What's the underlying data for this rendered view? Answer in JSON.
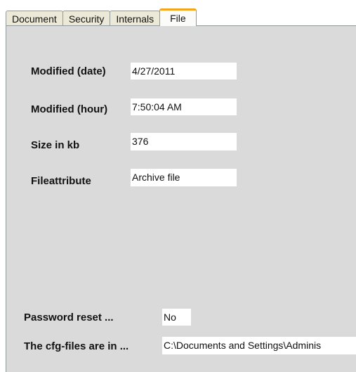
{
  "tabs": [
    {
      "label": "Document"
    },
    {
      "label": "Security"
    },
    {
      "label": "Internals"
    },
    {
      "label": "File",
      "active": true
    }
  ],
  "fields": {
    "modified_date": {
      "label": "Modified (date)",
      "value": "4/27/2011"
    },
    "modified_hour": {
      "label": "Modified (hour)",
      "value": "7:50:04 AM"
    },
    "size_kb": {
      "label": "Size in kb",
      "value": "376"
    },
    "file_attribute": {
      "label": "Fileattribute",
      "value": "Archive file"
    },
    "password_reset": {
      "label": "Password reset ...",
      "value": "No"
    },
    "cfg_files": {
      "label": "The cfg-files are in ...",
      "value": "C:\\Documents and Settings\\Adminis"
    }
  },
  "colors": {
    "panel_bg": "#dadada",
    "active_tab_accent": "#f5a51c",
    "tab_border": "#919b9c"
  }
}
